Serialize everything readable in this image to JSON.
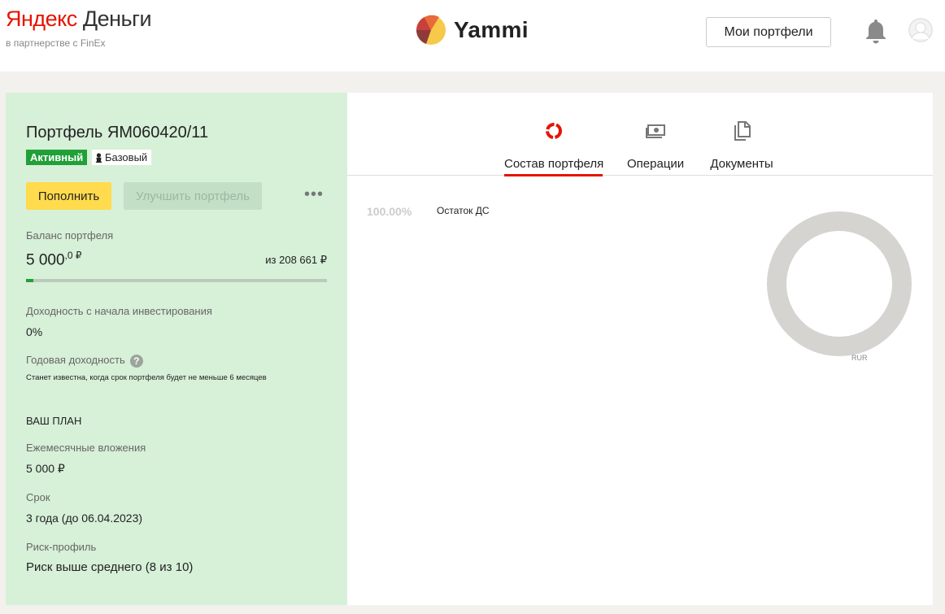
{
  "header": {
    "brand_ya": "Яндекс",
    "brand_dengi": "Деньги",
    "partner_text": "в партнерстве с FinEx",
    "app_name": "Yammi",
    "my_portfolios_label": "Мои портфели"
  },
  "portfolio": {
    "title": "Портфель ЯМ060420/11",
    "status_badge": "Активный",
    "tier_badge": "Базовый",
    "fill_button": "Пополнить",
    "improve_button": "Улучшить портфель",
    "more_label": "•••",
    "balance_label": "Баланс портфеля",
    "balance_main": "5 000",
    "balance_decimal": ",0 ₽",
    "balance_of": "из 208 661 ₽",
    "balance_progress": 0.024,
    "yield_since_start_label": "Доходность с начала инвестирования",
    "yield_since_start_value": "0%",
    "annual_yield_label": "Годовая доходность",
    "annual_yield_note": "Станет известна, когда срок портфеля будет не меньше 6 месяцев",
    "plan_heading": "ВАШ ПЛАН",
    "monthly_label": "Ежемесячные вложения",
    "monthly_value": "5 000 ₽",
    "term_label": "Срок",
    "term_value": "3 года (до 06.04.2023)",
    "risk_label": "Риск-профиль",
    "risk_value": "Риск выше среднего (8 из 10)"
  },
  "tabs": [
    {
      "label": "Состав портфеля",
      "icon": "pie-ring-icon",
      "active": true
    },
    {
      "label": "Операции",
      "icon": "banknote-icon",
      "active": false
    },
    {
      "label": "Документы",
      "icon": "documents-icon",
      "active": false
    }
  ],
  "composition": {
    "share": "100.00%",
    "asset": "Остаток ДС",
    "currency_label": "RUR"
  },
  "chart_data": {
    "type": "pie",
    "categories": [
      "Остаток ДС"
    ],
    "values": [
      100.0
    ],
    "colors": [
      "#d5d4d0"
    ]
  },
  "colors": {
    "accent_red": "#e61400",
    "active_green": "#21a038",
    "fill_button_yellow": "#ffdb4d",
    "panel_green": "#d7f0d8"
  }
}
